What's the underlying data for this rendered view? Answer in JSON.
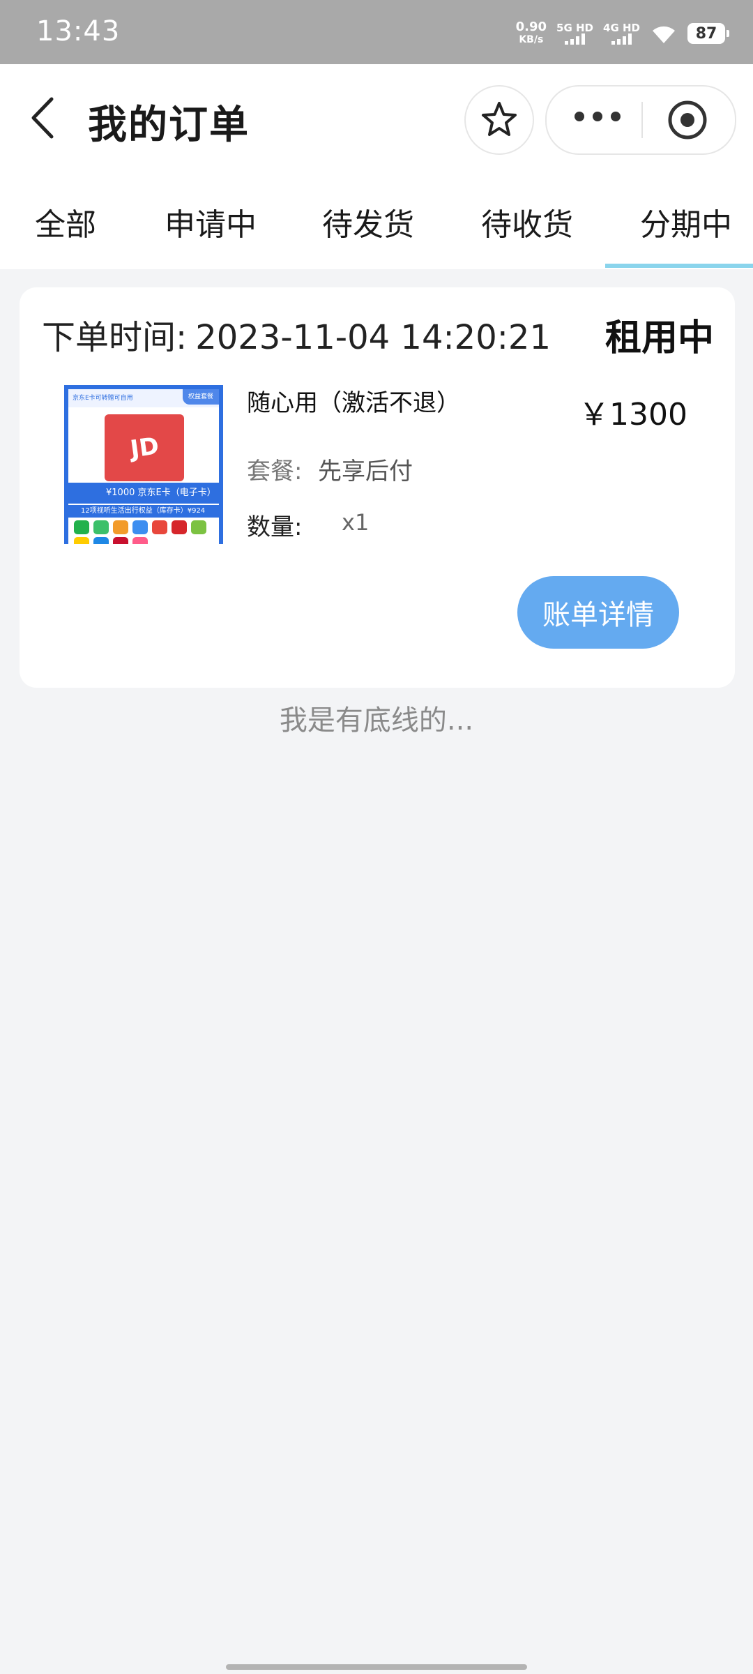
{
  "status_bar": {
    "time": "13:43",
    "speed_value": "0.90",
    "speed_unit": "KB/s",
    "net1": "5G HD",
    "net2": "4G HD",
    "battery": "87"
  },
  "header": {
    "title": "我的订单"
  },
  "tabs": [
    {
      "label": "全部"
    },
    {
      "label": "申请中"
    },
    {
      "label": "待发货"
    },
    {
      "label": "待收货"
    },
    {
      "label": "分期中",
      "active": true
    }
  ],
  "order": {
    "time_label": "下单时间:",
    "time_value": "2023-11-04 14:20:21",
    "status": "租用中",
    "product_name": "随心用（激活不退）",
    "price": "￥1300",
    "package_label": "套餐:",
    "package_value": "先享后付",
    "quantity_label": "数量:",
    "quantity_value": "x1",
    "bill_button": "账单详情",
    "thumbnail": {
      "top_text": "京东E卡可转赠可自用",
      "tag": "权益套餐",
      "card_text": "JD",
      "band1": "¥1000 京东E卡（电子卡）",
      "band2": "12项视听生活出行权益（库存卡）¥924"
    }
  },
  "footer_text": "我是有底线的...",
  "colors": {
    "accent": "#64aaf0",
    "tab_indicator": "#8ad4ec",
    "background": "#f3f4f6"
  }
}
